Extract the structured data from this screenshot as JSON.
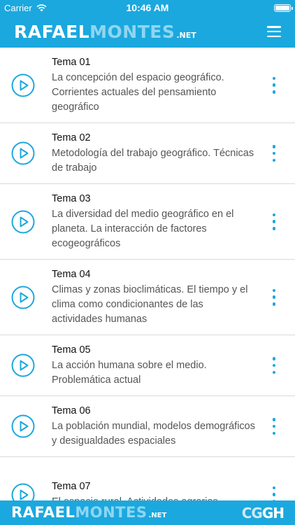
{
  "status_bar": {
    "carrier": "Carrier",
    "time": "10:46 AM"
  },
  "header": {
    "logo_part1": "RAFAEL",
    "logo_part2": "MONTES",
    "logo_suffix": ".NET"
  },
  "topics": [
    {
      "title": "Tema 01",
      "description": "La concepción del espacio geográfico. Corrientes actuales del pensamiento geográfico"
    },
    {
      "title": "Tema 02",
      "description": "Metodología del trabajo geográfico. Técnicas de trabajo"
    },
    {
      "title": "Tema 03",
      "description": "La diversidad del medio geográfico en el planeta. La interacción de factores ecogeográficos"
    },
    {
      "title": "Tema 04",
      "description": "Climas y zonas bioclimáticas. El tiempo y el clima como condicionantes de las actividades humanas"
    },
    {
      "title": "Tema 05",
      "description": "La acción humana sobre el medio. Problemática actual"
    },
    {
      "title": "Tema 06",
      "description": "La población mundial, modelos demográficos y desigualdades espaciales"
    },
    {
      "title": "Tema 07",
      "description": "El espacio rural. Actividades agrarias,"
    }
  ],
  "footer": {
    "logo_part1": "RAFAEL",
    "logo_part2": "MONTES",
    "logo_suffix": ".NET",
    "brand_a": "CG",
    "brand_b": "GH"
  },
  "colors": {
    "accent": "#1ba8de"
  },
  "icons": {
    "play": "play-circle-icon",
    "more": "more-vertical-icon",
    "menu": "hamburger-menu-icon",
    "wifi": "wifi-icon",
    "battery": "battery-icon"
  }
}
